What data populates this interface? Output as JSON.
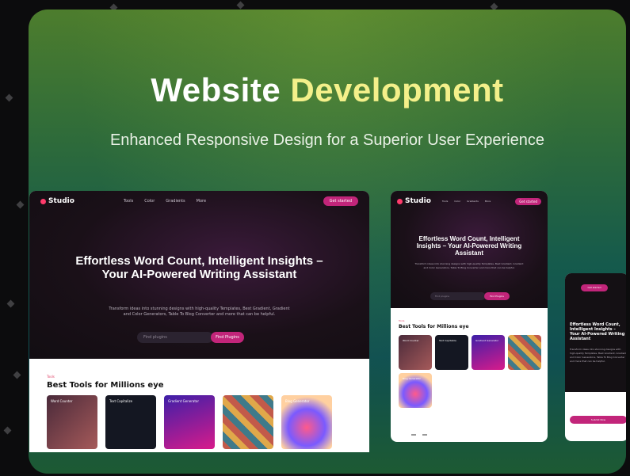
{
  "banner": {
    "title_main": "Website",
    "title_highlight": "Development",
    "subtitle": "Enhanced Responsive Design for a Superior User Experience"
  },
  "desktop": {
    "logo": "Studio",
    "nav": [
      "Tools",
      "Color",
      "Gradients",
      "More"
    ],
    "cta": "Get started",
    "heading": "Effortless Word Count, Intelligent Insights – Your AI-Powered Writing Assistant",
    "description": "Transform ideas into stunning designs with high-quality Templates, Best Gradient, Gradient and Color Generators, Table To Blog Converter and more that can be helpful.",
    "search_placeholder": "Find plugins",
    "search_button": "Find Plugins",
    "section_tag": "Tools",
    "section_title": "Best Tools for Millions eye",
    "tools": [
      {
        "label": "Word Counter",
        "color": "#7a2b4a"
      },
      {
        "label": "Text Capitalize",
        "color": "#141722"
      },
      {
        "label": "Gradient Generator",
        "color": "#6e1fa8"
      },
      {
        "label": "",
        "color": "#b84a5a"
      },
      {
        "label": "Blog Generator",
        "color": "#ffb14a"
      }
    ]
  },
  "tablet": {
    "logo": "Studio",
    "heading": "Effortless Word Count, Intelligent Insights – Your AI-Powered Writing Assistant",
    "search_button": "Find Plugins",
    "section_title": "Best Tools for Millions eye"
  },
  "phone": {
    "cta": "Get started",
    "heading": "Effortless Word Count, Intelligent Insights – Your AI-Powered Writing Assistant",
    "button": "Submit Now"
  }
}
